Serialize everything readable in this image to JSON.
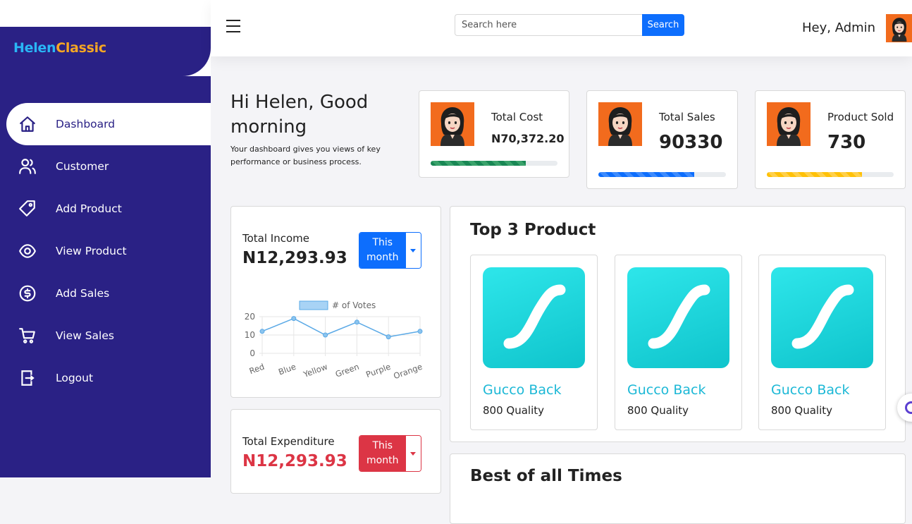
{
  "brand": {
    "part1": "Helen",
    "part2": "Classic"
  },
  "sidebar": {
    "items": [
      {
        "label": "Dashboard",
        "icon": "home-icon"
      },
      {
        "label": "Customer",
        "icon": "users-icon"
      },
      {
        "label": "Add Product",
        "icon": "tag-icon"
      },
      {
        "label": "View Product",
        "icon": "eye-icon"
      },
      {
        "label": "Add Sales",
        "icon": "coin-icon"
      },
      {
        "label": "View Sales",
        "icon": "cart-icon"
      },
      {
        "label": "Logout",
        "icon": "logout-icon"
      }
    ]
  },
  "topbar": {
    "search_placeholder": "Search here",
    "search_button": "Search",
    "greeting": "Hey, Admin"
  },
  "hello": {
    "title": "Hi Helen, Good morning",
    "subtitle": "Your dashboard gives you views of key performance or business process."
  },
  "stats": [
    {
      "title": "Total Cost",
      "value": "N70,372.20",
      "progress": 0.75,
      "color": "#198754"
    },
    {
      "title": "Total Sales",
      "value": "90330",
      "progress": 0.75,
      "color": "#0d6efd"
    },
    {
      "title": "Product Sold",
      "value": "730",
      "progress": 0.75,
      "color": "#ffc107"
    }
  ],
  "income": {
    "label": "Total Income",
    "value": "N12,293.93",
    "period_button": "This month"
  },
  "expenditure": {
    "label": "Total Expenditure",
    "value": "N12,293.93",
    "period_button": "This month"
  },
  "chart_data": {
    "type": "line",
    "categories": [
      "Red",
      "Blue",
      "Yellow",
      "Green",
      "Purple",
      "Orange"
    ],
    "series": [
      {
        "name": "# of Votes",
        "values": [
          12,
          19,
          10,
          17,
          9,
          12
        ]
      }
    ],
    "ylim": [
      0,
      20
    ],
    "yticks": [
      "0",
      "10",
      "20"
    ],
    "legend": "top",
    "color": "#5aa9e6"
  },
  "top3": {
    "title": "Top 3 Product",
    "products": [
      {
        "name": "Gucco Back",
        "quality": "800 Quality"
      },
      {
        "name": "Gucco Back",
        "quality": "800 Quality"
      },
      {
        "name": "Gucco Back",
        "quality": "800 Quality"
      }
    ]
  },
  "best": {
    "title": "Best of all Times"
  }
}
